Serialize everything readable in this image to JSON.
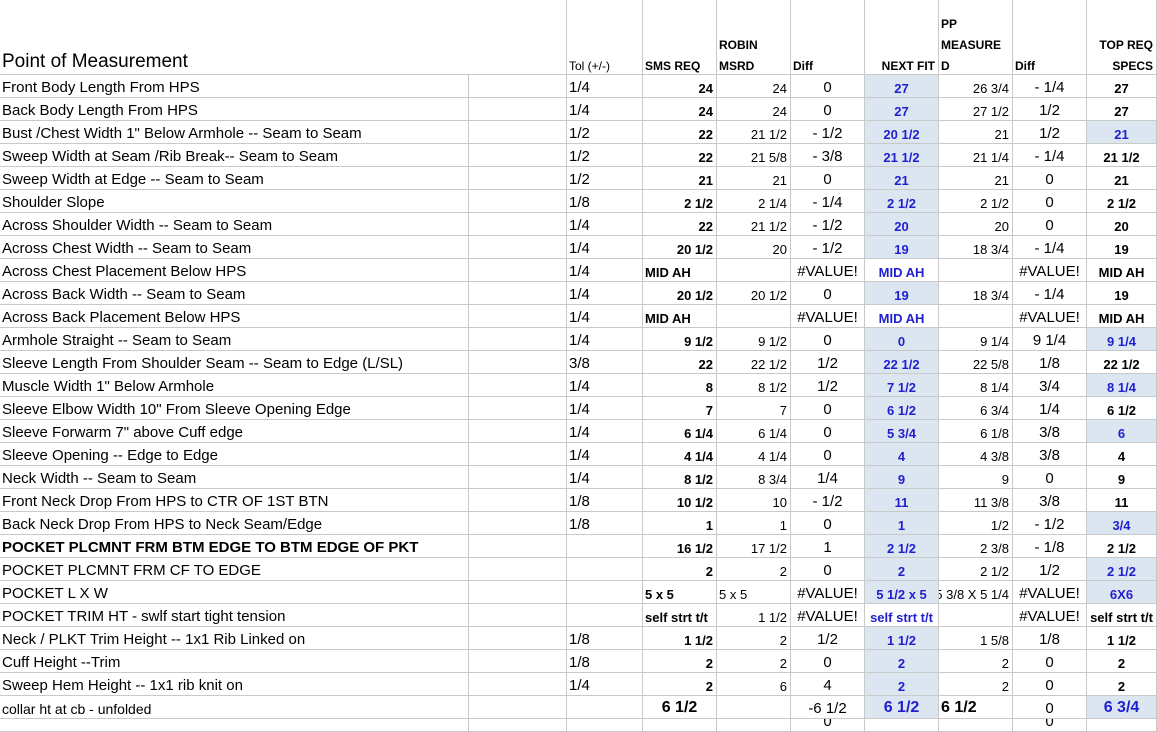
{
  "header": {
    "point_of_measurement": "Point of Measurement",
    "tol": "Tol (+/-)",
    "sms_req": "SMS REQ",
    "robin_line1": "ROBIN",
    "robin_line2": "MSRD",
    "diff": "Diff",
    "next_fit": "NEXT FIT",
    "pp_line1": "PP",
    "pp_line2": "MEASURE",
    "pp_line3": "D",
    "diff2": "Diff",
    "top_line1": "TOP REQ",
    "top_line2": "SPECS"
  },
  "rows": [
    [
      "Front Body Length From HPS",
      "1/4",
      "24",
      "24",
      "0",
      "27",
      "26 3/4",
      "- 1/4",
      "27"
    ],
    [
      "Back Body Length From HPS",
      "1/4",
      "24",
      "24",
      "0",
      "27",
      "27 1/2",
      "1/2",
      "27"
    ],
    [
      "Bust /Chest Width 1\" Below Armhole -- Seam to Seam",
      "1/2",
      "22",
      "21 1/2",
      "- 1/2",
      "20 1/2",
      "21",
      "1/2",
      "21"
    ],
    [
      "Sweep Width at Seam /Rib Break-- Seam to Seam",
      "1/2",
      "22",
      "21 5/8",
      "- 3/8",
      "21 1/2",
      "21 1/4",
      "- 1/4",
      "21 1/2"
    ],
    [
      "Sweep Width at Edge  -- Seam to Seam",
      "1/2",
      "21",
      "21",
      "0",
      "21",
      "21",
      "0",
      "21"
    ],
    [
      "Shoulder Slope",
      "1/8",
      "2 1/2",
      "2 1/4",
      "- 1/4",
      "2 1/2",
      "2 1/2",
      "0",
      "2 1/2"
    ],
    [
      "Across Shoulder Width -- Seam to Seam",
      "1/4",
      "22",
      "21 1/2",
      "- 1/2",
      "20",
      "20",
      "0",
      "20"
    ],
    [
      "Across Chest Width  -- Seam to Seam",
      "1/4",
      "20 1/2",
      "20",
      "- 1/2",
      "19",
      "18 3/4",
      "- 1/4",
      "19"
    ],
    [
      "Across Chest Placement  Below HPS",
      "1/4",
      "MID AH",
      "",
      "#VALUE!",
      "MID AH",
      "",
      "#VALUE!",
      "MID AH"
    ],
    [
      "Across Back Width  -- Seam to Seam",
      "1/4",
      "20 1/2",
      "20 1/2",
      "0",
      "19",
      "18 3/4",
      "- 1/4",
      "19"
    ],
    [
      "Across Back Placement Below HPS",
      "1/4",
      "MID AH",
      "",
      "#VALUE!",
      "MID AH",
      "",
      "#VALUE!",
      "MID AH"
    ],
    [
      "Armhole Straight -- Seam to Seam",
      "1/4",
      "9 1/2",
      "9 1/2",
      "0",
      "0",
      "9 1/4",
      "9 1/4",
      "9 1/4"
    ],
    [
      "Sleeve Length From Shoulder Seam -- Seam to Edge  (L/SL)",
      "3/8",
      "22",
      "22 1/2",
      "1/2",
      "22 1/2",
      "22 5/8",
      "1/8",
      "22 1/2"
    ],
    [
      "Muscle Width 1\" Below Armhole",
      "1/4",
      "8",
      "8 1/2",
      "1/2",
      "7 1/2",
      "8 1/4",
      "3/4",
      "8 1/4"
    ],
    [
      "Sleeve Elbow Width 10\" From Sleeve Opening Edge",
      "1/4",
      "7",
      "7",
      "0",
      "6 1/2",
      "6 3/4",
      "1/4",
      "6 1/2"
    ],
    [
      "Sleeve Forwarm 7\" above Cuff edge",
      "1/4",
      "6 1/4",
      "6 1/4",
      "0",
      "5 3/4",
      "6 1/8",
      "3/8",
      "6"
    ],
    [
      "Sleeve Opening -- Edge to Edge",
      "1/4",
      "4 1/4",
      "4 1/4",
      "0",
      "4",
      "4 3/8",
      "3/8",
      "4"
    ],
    [
      "Neck Width -- Seam to Seam",
      "1/4",
      "8 1/2",
      "8 3/4",
      "1/4",
      "9",
      "9",
      "0",
      "9"
    ],
    [
      "Front Neck Drop From HPS to CTR OF 1ST BTN",
      "1/8",
      "10 1/2",
      "10",
      "- 1/2",
      "11",
      "11 3/8",
      "3/8",
      "11"
    ],
    [
      "Back Neck Drop From HPS to Neck Seam/Edge",
      "1/8",
      "1",
      "1",
      "0",
      "1",
      "1/2",
      "- 1/2",
      "3/4"
    ],
    [
      "POCKET PLCMNT FRM BTM EDGE TO BTM EDGE OF PKT",
      "",
      "16 1/2",
      "17 1/2",
      "1",
      "2 1/2",
      "2 3/8",
      "- 1/8",
      "2 1/2"
    ],
    [
      "POCKET PLCMNT FRM CF TO EDGE",
      "",
      "2",
      "2",
      "0",
      "2",
      "2 1/2",
      "1/2",
      "2 1/2"
    ],
    [
      "POCKET L X W",
      "",
      "5 x 5",
      "5 x 5",
      "#VALUE!",
      "5 1/2 x 5",
      "5 3/8 X 5 1/4",
      "#VALUE!",
      "6X6"
    ],
    [
      "POCKET TRIM HT - swlf start tight tension",
      "",
      "self strt t/t",
      "1 1/2",
      "#VALUE!",
      "self strt t/t",
      "",
      "#VALUE!",
      "self strt t/t"
    ],
    [
      "Neck / PLKT Trim  Height --  1x1 Rib Linked on",
      "1/8",
      "1 1/2",
      "2",
      "1/2",
      "1 1/2",
      "1 5/8",
      "1/8",
      "1 1/2"
    ],
    [
      "Cuff Height --Trim",
      "1/8",
      "2",
      "2",
      "0",
      "2",
      "2",
      "0",
      "2"
    ],
    [
      "Sweep Hem Height -- 1x1 rib knit on",
      "1/4",
      "2",
      "6",
      "4",
      "2",
      "2",
      "0",
      "2"
    ],
    [
      "collar ht at cb  - unfolded",
      "",
      "6 1/2",
      "",
      "-6 1/2",
      "6 1/2",
      "6 1/2",
      "0",
      "6 3/4"
    ]
  ],
  "trailing_row": [
    "",
    "",
    "",
    "",
    "0",
    "",
    "",
    "0",
    ""
  ],
  "styles": {
    "highlight_color": "#dce6f1",
    "blue_text_color": "#1f1fd0",
    "grid_color": "#c9c9c9"
  }
}
